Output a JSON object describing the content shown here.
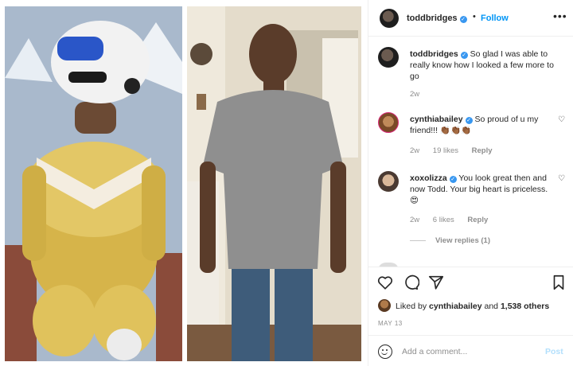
{
  "post": {
    "author": "toddbridges",
    "follow_label": "Follow",
    "separator": "•",
    "more_label": "•••",
    "caption_author": "toddbridges",
    "caption_text": "So glad I was able to really know how I looked a few more to go",
    "caption_age": "2w"
  },
  "comments": [
    {
      "user": "cynthiabailey",
      "text": "So proud of u my friend!!! 👏🏾👏🏾👏🏾",
      "age": "2w",
      "likes": "19 likes",
      "reply_label": "Reply"
    },
    {
      "user": "xoxolizza",
      "text": "You look great then and now Todd. Your big heart is priceless. 😍",
      "age": "2w",
      "likes": "6 likes",
      "reply_label": "Reply",
      "view_replies": "View replies (1)"
    }
  ],
  "likes": {
    "prefix": "Liked by",
    "liker": "cynthiabailey",
    "joiner": "and",
    "others": "1,538 others"
  },
  "date": "MAY 13",
  "add_comment": {
    "placeholder": "Add a comment...",
    "post_label": "Post"
  },
  "icons": {
    "heart": "heart-icon",
    "comment": "comment-icon",
    "share": "paper-plane-icon",
    "save": "bookmark-icon",
    "emoji": "smiley-icon",
    "verified": "verified-badge-icon"
  },
  "colors": {
    "link_blue": "#0095f6",
    "verified_blue": "#3897f0",
    "meta_gray": "#8e8e8e",
    "post_disabled": "#b2dffc"
  }
}
